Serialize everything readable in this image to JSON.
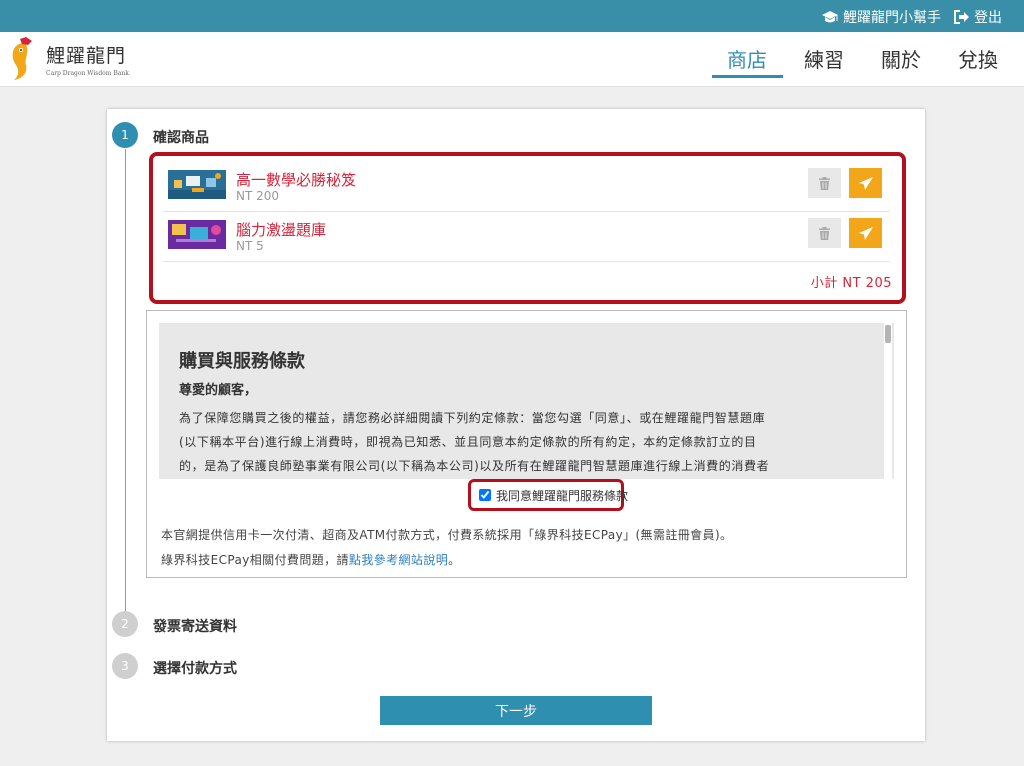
{
  "topbar": {
    "helper_label": "鯉躍龍門小幫手",
    "logout_label": "登出"
  },
  "header": {
    "logo_title": "鯉躍龍門",
    "logo_subtitle": "Carp Dragon Wisdom Bank",
    "nav": [
      "商店",
      "練習",
      "關於",
      "兌換"
    ],
    "active_nav": "商店"
  },
  "steps": [
    {
      "number": "1",
      "label": "確認商品",
      "active": true
    },
    {
      "number": "2",
      "label": "發票寄送資料",
      "active": false
    },
    {
      "number": "3",
      "label": "選擇付款方式",
      "active": false
    }
  ],
  "cart": {
    "items": [
      {
        "name": "高一數學必勝秘笈",
        "price": "NT 200",
        "thumb": "classroom-illustration"
      },
      {
        "name": "腦力激盪題庫",
        "price": "NT 5",
        "thumb": "purple-illustration"
      }
    ],
    "subtotal": "小計 NT 205"
  },
  "terms": {
    "title": "購買與服務條款",
    "greeting": "尊愛的顧客，",
    "lines": [
      "為了保障您購買之後的權益，請您務必詳細閱讀下列約定條款：當您勾選「同意」、或在鯉躍龍門智慧題庫",
      "(以下稱本平台)進行線上消費時，即視為已知悉、並且同意本約定條款的所有約定，本約定條款訂立的目",
      "的，是為了保護良師塾事業有限公司(以下稱為本公司)以及所有在鯉躍龍門智慧題庫進行線上消費的消費者"
    ],
    "agree_label": "我同意鯉躍龍門服務條款",
    "agree_checked": true
  },
  "payment_info": {
    "line1": "本官網提供信用卡一次付清、超商及ATM付款方式，付費系統採用「綠界科技ECPay」(無需註冊會員)。",
    "line2_prefix": "綠界科技ECPay相關付費問題，請",
    "line2_link": "點我參考網站說明",
    "line2_suffix": "。"
  },
  "next_button": "下一步",
  "colors": {
    "topbar": "#3a8fa8",
    "accent": "#2f8fb0",
    "highlight_border": "#b50e1c",
    "item_name": "#d6253a",
    "send_button": "#f2a71b"
  },
  "icons": [
    "graduation-cap-icon",
    "logout-icon",
    "carp-logo-icon",
    "trash-icon",
    "paper-plane-icon"
  ]
}
